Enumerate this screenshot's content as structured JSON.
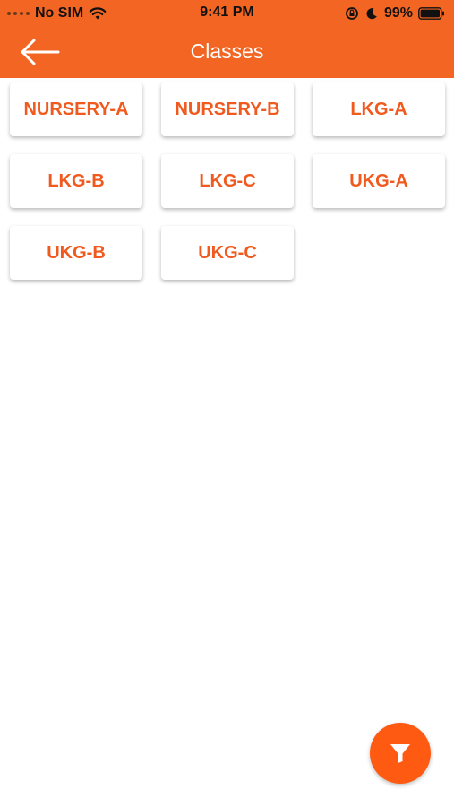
{
  "status_bar": {
    "carrier": "No SIM",
    "time": "9:41 PM",
    "battery": "99%"
  },
  "header": {
    "title": "Classes",
    "back_icon": "arrow-left-icon"
  },
  "classes": [
    {
      "label": "NURSERY-A"
    },
    {
      "label": "NURSERY-B"
    },
    {
      "label": "LKG-A"
    },
    {
      "label": "LKG-B"
    },
    {
      "label": "LKG-C"
    },
    {
      "label": "UKG-A"
    },
    {
      "label": "UKG-B"
    },
    {
      "label": "UKG-C"
    }
  ],
  "fab": {
    "icon": "filter-icon"
  },
  "colors": {
    "header": "#f26522",
    "accent": "#f05a1f",
    "fab": "#ff5a12"
  }
}
